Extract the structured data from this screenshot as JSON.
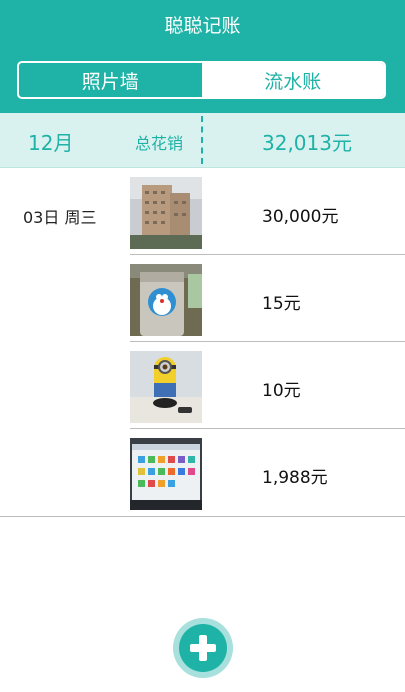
{
  "app": {
    "title": "聪聪记账"
  },
  "tabs": [
    {
      "label": "照片墙",
      "active": false
    },
    {
      "label": "流水账",
      "active": true
    }
  ],
  "summary": {
    "month": "12月",
    "label": "总花销",
    "total": "32,013元"
  },
  "days": [
    {
      "label": "03日 周三",
      "entries": [
        {
          "amount": "30,000元",
          "photo": "building-photo"
        },
        {
          "amount": "15元",
          "photo": "doraemon-cup-photo"
        },
        {
          "amount": "10元",
          "photo": "minion-figure-photo"
        },
        {
          "amount": "1,988元",
          "photo": "monitor-screen-photo"
        }
      ]
    }
  ],
  "fab": {
    "icon": "plus-icon"
  },
  "colors": {
    "accent": "#1fb2a6",
    "summary_bg": "#d9f2f0"
  }
}
